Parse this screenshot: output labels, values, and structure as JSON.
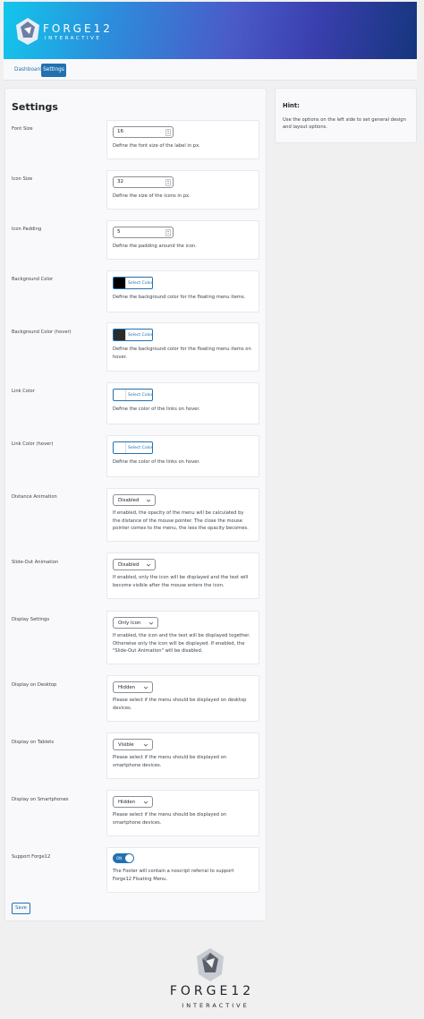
{
  "brand": {
    "wordmark": "FORGE12",
    "subtitle": "INTERACTIVE"
  },
  "nav": {
    "dashboard": "Dashboard",
    "settings": "Settings"
  },
  "settings": {
    "title": "Settings",
    "font_size": {
      "label": "Font Size",
      "value": "16",
      "desc": "Define the font size of the label in px."
    },
    "icon_size": {
      "label": "Icon Size",
      "value": "32",
      "desc": "Define the size of the icons in px."
    },
    "icon_padding": {
      "label": "Icon Padding",
      "value": "5",
      "desc": "Define the padding around the icon."
    },
    "bg_color": {
      "label": "Background Color",
      "button": "Select Color",
      "color": "#000000",
      "desc": "Define the background color for the floating menu items."
    },
    "bg_color_hover": {
      "label": "Background Color (hover)",
      "button": "Select Color",
      "color": "#2c2c2c",
      "desc": "Define the background color for the floating menu items on hover."
    },
    "link_color": {
      "label": "Link Color",
      "button": "Select Color",
      "color": "#ffffff",
      "desc": "Define the color of the links on hover."
    },
    "link_color_hover": {
      "label": "Link Color (hover)",
      "button": "Select Color",
      "color": "#ffffff",
      "desc": "Define the color of the links on hover."
    },
    "distance_animation": {
      "label": "Distance Animation",
      "value": "Disabled",
      "desc": "If enabled, the opacity of the menu will be calculated by the distance of the mouse pointer. The close the mouse pointer comes to the menu, the less the opacity becomes."
    },
    "slide_out": {
      "label": "Slide-Out Animation",
      "value": "Disabled",
      "desc": "If enabled, only the icon will be displayed and the text will become visible after the mouse enters the icon."
    },
    "display_settings": {
      "label": "Display Settings",
      "value": "Only Icon",
      "desc": "If enabled, the icon and the text will be displayed together. Otherwise only the icon will be displayed. If enabled, the \"Slide-Out Animation\" will be disabled."
    },
    "display_desktop": {
      "label": "Display on Desktop",
      "value": "Hidden",
      "desc": "Please select if the menu should be displayed on desktop devices."
    },
    "display_tablets": {
      "label": "Display on Tablets",
      "value": "Visible",
      "desc": "Please select if the menu should be displayed on smartphone devices."
    },
    "display_smartphones": {
      "label": "Display on Smartphones",
      "value": "Hidden",
      "desc": "Please select if the menu should be displayed on smartphone devices."
    },
    "support": {
      "label": "Support Forge12",
      "toggle": "ON",
      "desc": "The Footer will contain a noscript referral to support Forge12 Floating Menu."
    },
    "save": "Save"
  },
  "hint": {
    "title": "Hint:",
    "text": "Use the options on the left side to set general design and layout options."
  },
  "colors": {
    "accent": "#2271b1",
    "page_bg": "#f0f0f1"
  }
}
